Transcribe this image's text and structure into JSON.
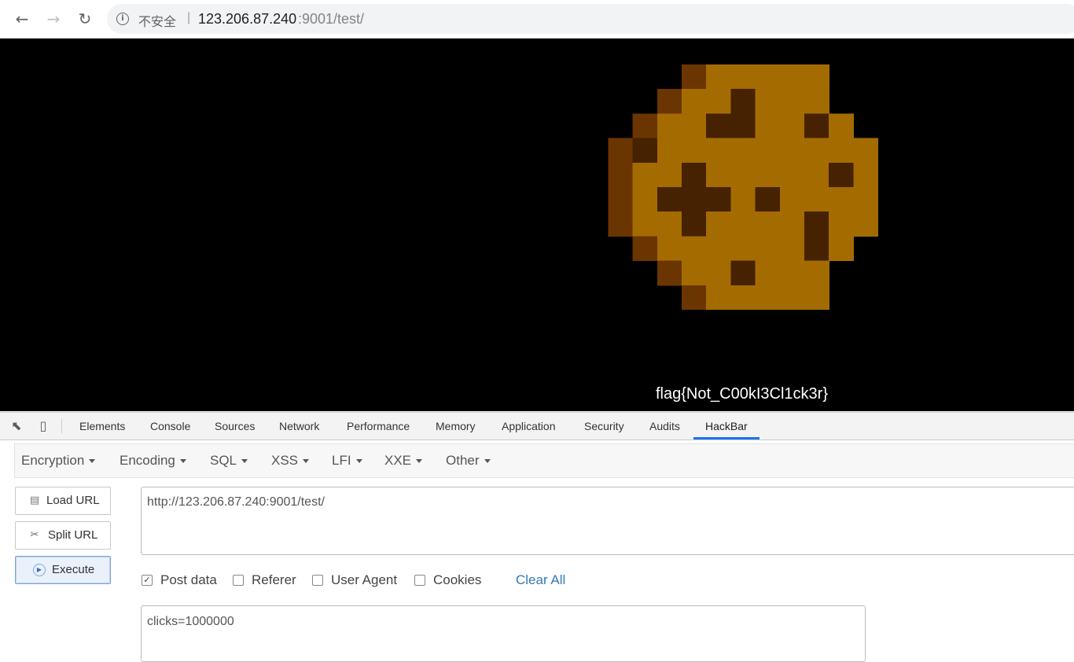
{
  "browser": {
    "security_label": "不安全",
    "separator": "|",
    "url_host": "123.206.87.240",
    "url_path": ":9001/test/"
  },
  "page": {
    "flag_text": "flag{Not_C00kI3Cl1ck3r}",
    "background": "#000000",
    "cookie_colors": {
      "light": "#a46b00",
      "dark": "#472200",
      "edge": "#6b3502"
    }
  },
  "devtools": {
    "tabs": [
      "Elements",
      "Console",
      "Sources",
      "Network",
      "Performance",
      "Memory",
      "Application",
      "Security",
      "Audits",
      "HackBar"
    ],
    "active_tab": "HackBar"
  },
  "hackbar": {
    "menu": [
      "Encryption",
      "Encoding",
      "SQL",
      "XSS",
      "LFI",
      "XXE",
      "Other"
    ],
    "buttons": {
      "load_url": "Load URL",
      "split_url": "Split URL",
      "execute": "Execute"
    },
    "url_value": "http://123.206.87.240:9001/test/",
    "options": {
      "post_data": {
        "label": "Post data",
        "checked": true
      },
      "referer": {
        "label": "Referer",
        "checked": false
      },
      "user_agent": {
        "label": "User Agent",
        "checked": false
      },
      "cookies": {
        "label": "Cookies",
        "checked": false
      }
    },
    "clear_all": "Clear All",
    "post_value": "clicks=1000000"
  }
}
